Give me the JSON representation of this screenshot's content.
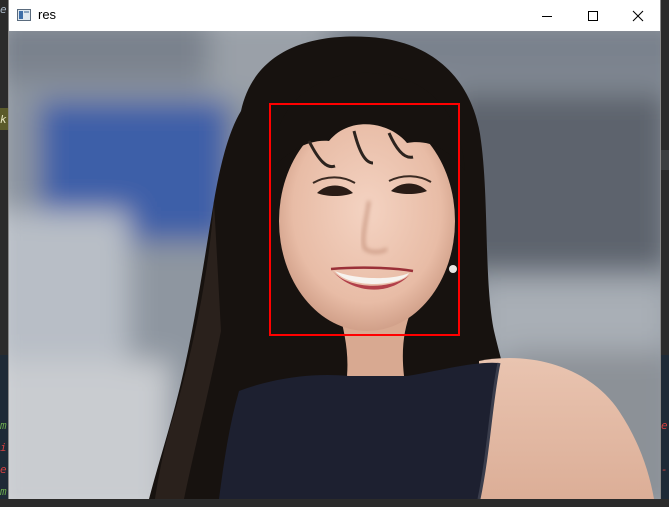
{
  "window": {
    "title": "res",
    "icon": "app-window-icon",
    "controls": {
      "minimize_icon": "minimize-icon",
      "maximize_icon": "maximize-icon",
      "close_icon": "close-icon"
    }
  },
  "image": {
    "content": "photo",
    "detection": {
      "label": "face",
      "box_color": "#ff0000"
    }
  },
  "background_editor": {
    "left_glyphs": [
      "e",
      "k",
      "m",
      "i",
      "e",
      "m"
    ],
    "right_glyphs": [
      "e",
      "-"
    ]
  }
}
